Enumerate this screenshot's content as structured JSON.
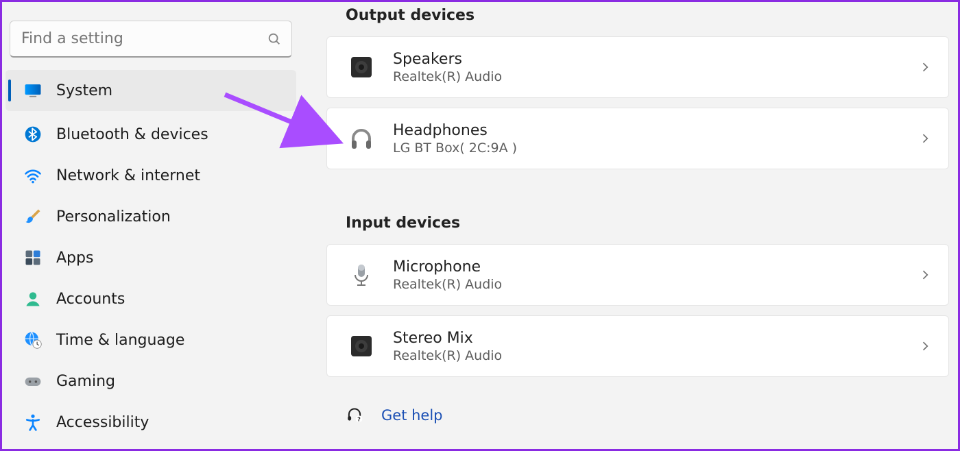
{
  "search": {
    "placeholder": "Find a setting"
  },
  "nav": {
    "items": [
      {
        "id": "system",
        "label": "System",
        "icon": "display",
        "selected": true
      },
      {
        "id": "bluetooth",
        "label": "Bluetooth & devices",
        "icon": "bluetooth",
        "selected": false
      },
      {
        "id": "network",
        "label": "Network & internet",
        "icon": "wifi",
        "selected": false
      },
      {
        "id": "personalization",
        "label": "Personalization",
        "icon": "brush",
        "selected": false
      },
      {
        "id": "apps",
        "label": "Apps",
        "icon": "apps",
        "selected": false
      },
      {
        "id": "accounts",
        "label": "Accounts",
        "icon": "person",
        "selected": false
      },
      {
        "id": "time",
        "label": "Time & language",
        "icon": "globe-clock",
        "selected": false
      },
      {
        "id": "gaming",
        "label": "Gaming",
        "icon": "gamepad",
        "selected": false
      },
      {
        "id": "accessibility",
        "label": "Accessibility",
        "icon": "accessibility",
        "selected": false
      }
    ]
  },
  "content": {
    "sections": [
      {
        "id": "output",
        "title": "Output devices",
        "devices": [
          {
            "id": "speakers",
            "title": "Speakers",
            "subtitle": "Realtek(R) Audio",
            "icon": "speaker"
          },
          {
            "id": "headphones",
            "title": "Headphones",
            "subtitle": "LG BT Box( 2C:9A )",
            "icon": "headphones"
          }
        ]
      },
      {
        "id": "input",
        "title": "Input devices",
        "devices": [
          {
            "id": "microphone",
            "title": "Microphone",
            "subtitle": "Realtek(R) Audio",
            "icon": "mic"
          },
          {
            "id": "stereomix",
            "title": "Stereo Mix",
            "subtitle": "Realtek(R) Audio",
            "icon": "speaker"
          }
        ]
      }
    ],
    "help_label": "Get help"
  },
  "annotation": {
    "arrow_target": "headphones"
  }
}
